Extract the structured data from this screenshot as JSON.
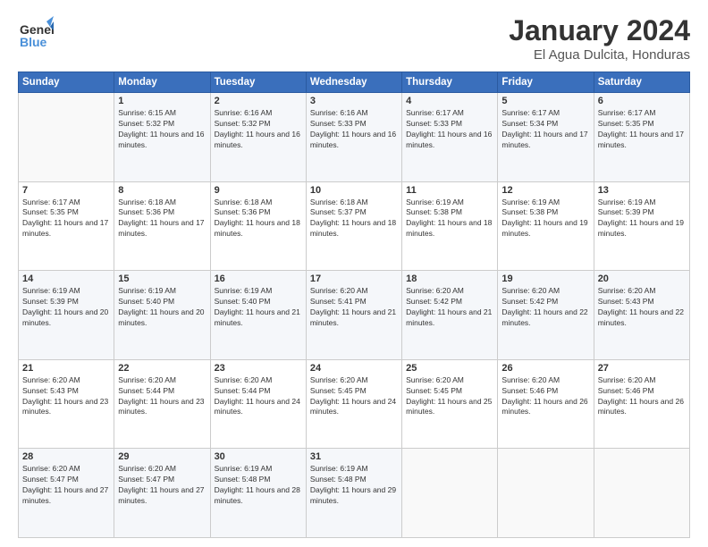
{
  "logo": {
    "general": "General",
    "blue": "Blue"
  },
  "title": "January 2024",
  "subtitle": "El Agua Dulcita, Honduras",
  "days_header": [
    "Sunday",
    "Monday",
    "Tuesday",
    "Wednesday",
    "Thursday",
    "Friday",
    "Saturday"
  ],
  "weeks": [
    [
      {
        "day": "",
        "sunrise": "",
        "sunset": "",
        "daylight": ""
      },
      {
        "day": "1",
        "sunrise": "Sunrise: 6:15 AM",
        "sunset": "Sunset: 5:32 PM",
        "daylight": "Daylight: 11 hours and 16 minutes."
      },
      {
        "day": "2",
        "sunrise": "Sunrise: 6:16 AM",
        "sunset": "Sunset: 5:32 PM",
        "daylight": "Daylight: 11 hours and 16 minutes."
      },
      {
        "day": "3",
        "sunrise": "Sunrise: 6:16 AM",
        "sunset": "Sunset: 5:33 PM",
        "daylight": "Daylight: 11 hours and 16 minutes."
      },
      {
        "day": "4",
        "sunrise": "Sunrise: 6:17 AM",
        "sunset": "Sunset: 5:33 PM",
        "daylight": "Daylight: 11 hours and 16 minutes."
      },
      {
        "day": "5",
        "sunrise": "Sunrise: 6:17 AM",
        "sunset": "Sunset: 5:34 PM",
        "daylight": "Daylight: 11 hours and 17 minutes."
      },
      {
        "day": "6",
        "sunrise": "Sunrise: 6:17 AM",
        "sunset": "Sunset: 5:35 PM",
        "daylight": "Daylight: 11 hours and 17 minutes."
      }
    ],
    [
      {
        "day": "7",
        "sunrise": "Sunrise: 6:17 AM",
        "sunset": "Sunset: 5:35 PM",
        "daylight": "Daylight: 11 hours and 17 minutes."
      },
      {
        "day": "8",
        "sunrise": "Sunrise: 6:18 AM",
        "sunset": "Sunset: 5:36 PM",
        "daylight": "Daylight: 11 hours and 17 minutes."
      },
      {
        "day": "9",
        "sunrise": "Sunrise: 6:18 AM",
        "sunset": "Sunset: 5:36 PM",
        "daylight": "Daylight: 11 hours and 18 minutes."
      },
      {
        "day": "10",
        "sunrise": "Sunrise: 6:18 AM",
        "sunset": "Sunset: 5:37 PM",
        "daylight": "Daylight: 11 hours and 18 minutes."
      },
      {
        "day": "11",
        "sunrise": "Sunrise: 6:19 AM",
        "sunset": "Sunset: 5:38 PM",
        "daylight": "Daylight: 11 hours and 18 minutes."
      },
      {
        "day": "12",
        "sunrise": "Sunrise: 6:19 AM",
        "sunset": "Sunset: 5:38 PM",
        "daylight": "Daylight: 11 hours and 19 minutes."
      },
      {
        "day": "13",
        "sunrise": "Sunrise: 6:19 AM",
        "sunset": "Sunset: 5:39 PM",
        "daylight": "Daylight: 11 hours and 19 minutes."
      }
    ],
    [
      {
        "day": "14",
        "sunrise": "Sunrise: 6:19 AM",
        "sunset": "Sunset: 5:39 PM",
        "daylight": "Daylight: 11 hours and 20 minutes."
      },
      {
        "day": "15",
        "sunrise": "Sunrise: 6:19 AM",
        "sunset": "Sunset: 5:40 PM",
        "daylight": "Daylight: 11 hours and 20 minutes."
      },
      {
        "day": "16",
        "sunrise": "Sunrise: 6:19 AM",
        "sunset": "Sunset: 5:40 PM",
        "daylight": "Daylight: 11 hours and 21 minutes."
      },
      {
        "day": "17",
        "sunrise": "Sunrise: 6:20 AM",
        "sunset": "Sunset: 5:41 PM",
        "daylight": "Daylight: 11 hours and 21 minutes."
      },
      {
        "day": "18",
        "sunrise": "Sunrise: 6:20 AM",
        "sunset": "Sunset: 5:42 PM",
        "daylight": "Daylight: 11 hours and 21 minutes."
      },
      {
        "day": "19",
        "sunrise": "Sunrise: 6:20 AM",
        "sunset": "Sunset: 5:42 PM",
        "daylight": "Daylight: 11 hours and 22 minutes."
      },
      {
        "day": "20",
        "sunrise": "Sunrise: 6:20 AM",
        "sunset": "Sunset: 5:43 PM",
        "daylight": "Daylight: 11 hours and 22 minutes."
      }
    ],
    [
      {
        "day": "21",
        "sunrise": "Sunrise: 6:20 AM",
        "sunset": "Sunset: 5:43 PM",
        "daylight": "Daylight: 11 hours and 23 minutes."
      },
      {
        "day": "22",
        "sunrise": "Sunrise: 6:20 AM",
        "sunset": "Sunset: 5:44 PM",
        "daylight": "Daylight: 11 hours and 23 minutes."
      },
      {
        "day": "23",
        "sunrise": "Sunrise: 6:20 AM",
        "sunset": "Sunset: 5:44 PM",
        "daylight": "Daylight: 11 hours and 24 minutes."
      },
      {
        "day": "24",
        "sunrise": "Sunrise: 6:20 AM",
        "sunset": "Sunset: 5:45 PM",
        "daylight": "Daylight: 11 hours and 24 minutes."
      },
      {
        "day": "25",
        "sunrise": "Sunrise: 6:20 AM",
        "sunset": "Sunset: 5:45 PM",
        "daylight": "Daylight: 11 hours and 25 minutes."
      },
      {
        "day": "26",
        "sunrise": "Sunrise: 6:20 AM",
        "sunset": "Sunset: 5:46 PM",
        "daylight": "Daylight: 11 hours and 26 minutes."
      },
      {
        "day": "27",
        "sunrise": "Sunrise: 6:20 AM",
        "sunset": "Sunset: 5:46 PM",
        "daylight": "Daylight: 11 hours and 26 minutes."
      }
    ],
    [
      {
        "day": "28",
        "sunrise": "Sunrise: 6:20 AM",
        "sunset": "Sunset: 5:47 PM",
        "daylight": "Daylight: 11 hours and 27 minutes."
      },
      {
        "day": "29",
        "sunrise": "Sunrise: 6:20 AM",
        "sunset": "Sunset: 5:47 PM",
        "daylight": "Daylight: 11 hours and 27 minutes."
      },
      {
        "day": "30",
        "sunrise": "Sunrise: 6:19 AM",
        "sunset": "Sunset: 5:48 PM",
        "daylight": "Daylight: 11 hours and 28 minutes."
      },
      {
        "day": "31",
        "sunrise": "Sunrise: 6:19 AM",
        "sunset": "Sunset: 5:48 PM",
        "daylight": "Daylight: 11 hours and 29 minutes."
      },
      {
        "day": "",
        "sunrise": "",
        "sunset": "",
        "daylight": ""
      },
      {
        "day": "",
        "sunrise": "",
        "sunset": "",
        "daylight": ""
      },
      {
        "day": "",
        "sunrise": "",
        "sunset": "",
        "daylight": ""
      }
    ]
  ]
}
